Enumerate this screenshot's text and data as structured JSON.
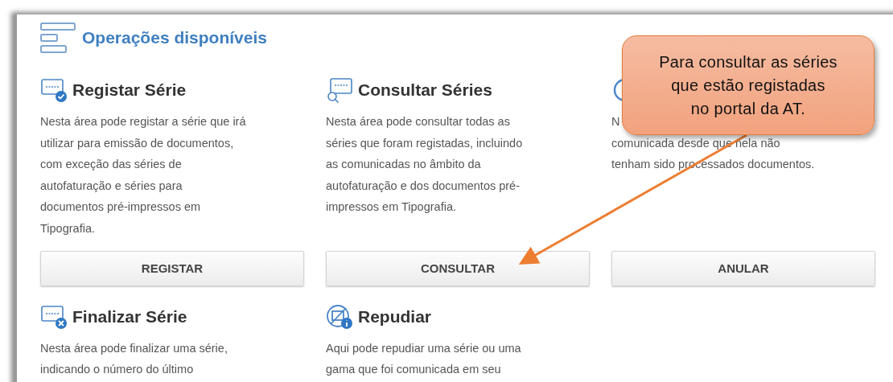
{
  "header": {
    "title": "Operações disponíveis"
  },
  "operations": [
    {
      "kind": "register",
      "title": "Registar Série",
      "description": [
        "Nesta área pode registar a série que irá",
        "utilizar para emissão de documentos,",
        "com exceção das séries de",
        "autofaturação e séries para",
        "documentos pré-impressos em",
        "Tipografia."
      ],
      "button": "REGISTAR"
    },
    {
      "kind": "consult",
      "title": "Consultar Séries",
      "description": [
        "Nesta área pode consultar todas as",
        "séries que foram registadas, incluindo",
        "as comunicadas no âmbito da",
        "autofaturação e dos documentos pré-",
        "impressos em Tipografia."
      ],
      "button": "CONSULTAR"
    },
    {
      "kind": "cancel",
      "description": [
        "N",
        "comunicada desde que nela não",
        "tenham sido processados documentos."
      ],
      "button": "ANULAR"
    },
    {
      "kind": "finalize",
      "title": "Finalizar Série",
      "description": [
        "Nesta área pode finalizar uma série,",
        "indicando o número do último"
      ]
    },
    {
      "kind": "repudiate",
      "title": "Repudiar",
      "description": [
        "Aqui pode repudiar uma série ou uma",
        "gama que foi comunicada em seu"
      ]
    }
  ],
  "callout": {
    "text": [
      "Para consultar as séries",
      "que estão registadas",
      "no portal da AT."
    ]
  }
}
